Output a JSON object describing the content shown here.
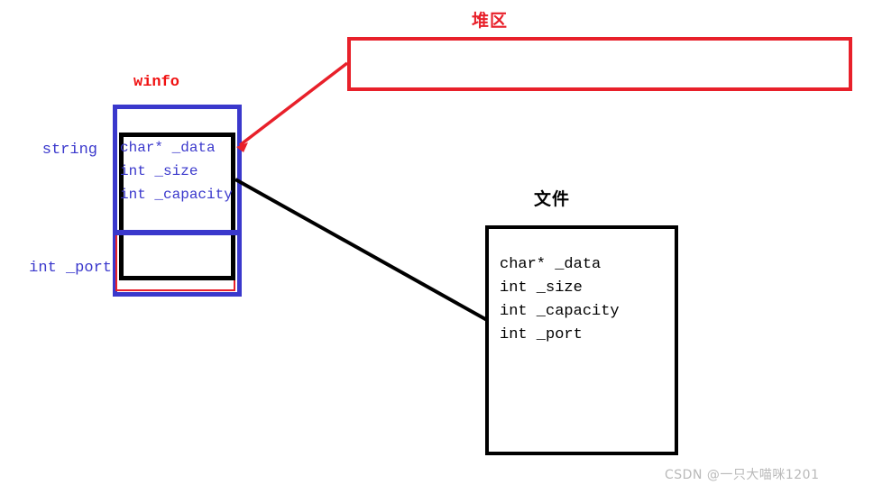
{
  "diagram": {
    "type": "memory-layout-diagram",
    "background": "#ffffff",
    "colors": {
      "red": "#e8202a",
      "blue": "#3a38cc",
      "black": "#000000",
      "watermark_gray": "#b9b9b9"
    }
  },
  "heap": {
    "title": "堆区",
    "box_stroke": "#e8202a"
  },
  "winfo": {
    "title": "winfo",
    "title_color": "#f01010",
    "outer_stroke": "#3a38cc",
    "inner_stroke": "#000000",
    "fields": [
      "char* _data",
      "int _size",
      "int _capacity"
    ],
    "annotations": {
      "upper": "string",
      "lower": "int _port"
    }
  },
  "file": {
    "title": "文件",
    "box_stroke": "#000000",
    "fields": [
      "char* _data",
      "int _size",
      "int _capacity",
      "int _port"
    ]
  },
  "connectors": [
    {
      "name": "winfo-data-to-heap",
      "color": "#e8202a",
      "from": "heap-box-left",
      "to": "winfo-data-field",
      "arrow_at": "to"
    },
    {
      "name": "winfo-to-file",
      "color": "#000000",
      "from": "winfo-right-edge",
      "to": "file-box-left",
      "arrow_at": "none"
    }
  ],
  "watermark": {
    "text": "CSDN @一只大喵咪1201"
  }
}
